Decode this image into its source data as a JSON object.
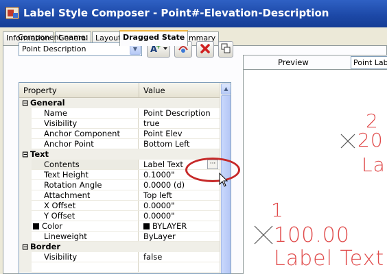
{
  "window": {
    "title": "Label Style Composer - Point#-Elevation-Description",
    "icon": "label-style-composer-icon"
  },
  "tabs": [
    {
      "label": "Information",
      "active": false
    },
    {
      "label": "General",
      "active": false
    },
    {
      "label": "Layout",
      "active": false
    },
    {
      "label": "Dragged State",
      "active": true
    },
    {
      "label": "Summary",
      "active": false
    }
  ],
  "component": {
    "label": "Component name:",
    "selected": "Point Description"
  },
  "toolbar": {
    "add_icon": "add-component-icon",
    "copy_icon": "copy-component-icon",
    "delete_icon": "delete-component-icon",
    "order_icon": "component-draw-order-icon"
  },
  "grid": {
    "header": {
      "property": "Property",
      "value": "Value"
    },
    "general": {
      "label": "General",
      "rows": [
        {
          "prop": "Name",
          "value": "Point Description"
        },
        {
          "prop": "Visibility",
          "value": "true"
        },
        {
          "prop": "Anchor Component",
          "value": "Point Elev"
        },
        {
          "prop": "Anchor Point",
          "value": "Bottom Left"
        }
      ]
    },
    "text": {
      "label": "Text",
      "rows": [
        {
          "prop": "Contents",
          "value": "Label Text"
        },
        {
          "prop": "Text Height",
          "value": "0.1000\""
        },
        {
          "prop": "Rotation Angle",
          "value": "0.0000 (d)"
        },
        {
          "prop": "Attachment",
          "value": "Top left"
        },
        {
          "prop": "X Offset",
          "value": "0.0000\""
        },
        {
          "prop": "Y Offset",
          "value": "0.0000\""
        },
        {
          "prop": "Color",
          "value": "BYLAYER"
        },
        {
          "prop": "Lineweight",
          "value": "ByLayer"
        }
      ]
    },
    "border": {
      "label": "Border",
      "rows": [
        {
          "prop": "Visibility",
          "value": "false"
        }
      ]
    }
  },
  "preview": {
    "title": "Preview",
    "select_value": "Point Label",
    "point2": {
      "number": "2",
      "elev": "20",
      "text": "La"
    },
    "point1": {
      "number": "1",
      "elev": "100.00",
      "text": "Label Text"
    }
  },
  "colors": {
    "accent_red": "#e04b4b",
    "callout_red": "#c62828",
    "titlebar_blue": "#1d49a8"
  }
}
